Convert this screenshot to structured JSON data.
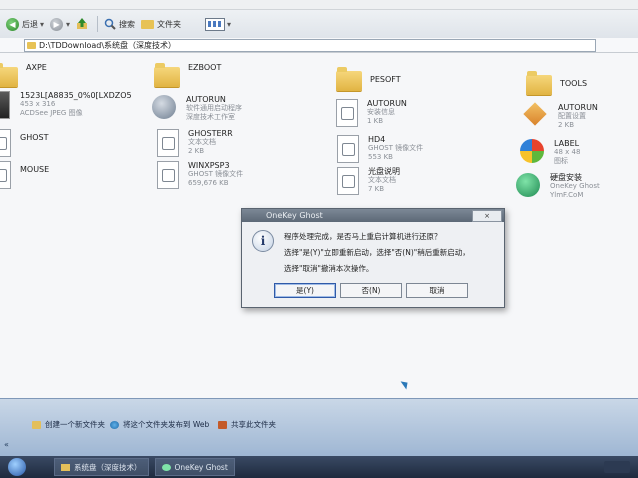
{
  "menubar": {
    "text": ""
  },
  "toolbar": {
    "back_label": "后退",
    "search_label": "搜索",
    "folders_label": "文件夹"
  },
  "address": {
    "path": "D:\\TDDownload\\系统盘（深度技术）"
  },
  "files": [
    {
      "name": "AXPE",
      "sub1": "",
      "sub2": "",
      "icon": "folder-icon"
    },
    {
      "name": "EZBOOT",
      "sub1": "",
      "sub2": "",
      "icon": "folder-icon"
    },
    {
      "name": "PESOFT",
      "sub1": "",
      "sub2": "",
      "icon": "folder-icon"
    },
    {
      "name": "TOOLS",
      "sub1": "",
      "sub2": "",
      "icon": "folder-icon"
    },
    {
      "name": "1523L[A8835_0%0[LXDZO5",
      "sub1": "453 x 316",
      "sub2": "ACDSee JPEG 图像",
      "icon": "image-icon"
    },
    {
      "name": "AUTORUN",
      "sub1": "软件通用启动程序",
      "sub2": "深度技术工作室",
      "icon": "app-icon"
    },
    {
      "name": "AUTORUN",
      "sub1": "安装信息",
      "sub2": "1 KB",
      "icon": "settings-file-icon"
    },
    {
      "name": "AUTORUN",
      "sub1": "配置设置",
      "sub2": "2 KB",
      "icon": "settings-file-icon"
    },
    {
      "name": "GHOST",
      "sub1": "",
      "sub2": "",
      "icon": "folder-icon"
    },
    {
      "name": "GHOSTERR",
      "sub1": "文本文档",
      "sub2": "2 KB",
      "icon": "text-file-icon"
    },
    {
      "name": "HD4",
      "sub1": "GHOST 镜像文件",
      "sub2": "553 KB",
      "icon": "ghost-file-icon"
    },
    {
      "name": "LABEL",
      "sub1": "48 x 48",
      "sub2": "图标",
      "icon": "windows-logo-icon"
    },
    {
      "name": "MOUSE",
      "sub1": "",
      "sub2": "",
      "icon": "folder-icon"
    },
    {
      "name": "WINXPSP3",
      "sub1": "GHOST 镜像文件",
      "sub2": "659,676 KB",
      "icon": "ghost-file-icon"
    },
    {
      "name": "光盘说明",
      "sub1": "文本文档",
      "sub2": "7 KB",
      "icon": "text-file-icon"
    },
    {
      "name": "硬盘安装",
      "sub1": "OneKey Ghost",
      "sub2": "YlmF.CoM",
      "icon": "onekey-ghost-icon"
    }
  ],
  "dialog": {
    "title": "OneKey Ghost",
    "close_label": "×",
    "line1": "程序处理完成，是否马上重启计算机进行还原？",
    "line2": "选择\"是(Y)\"立即重新启动，选择\"否(N)\"稍后重新启动，",
    "line3": "选择\"取消\"撤消本次操作。",
    "yes_label": "是(Y)",
    "no_label": "否(N)",
    "cancel_label": "取消"
  },
  "taskpane": {
    "link1": "创建一个新文件夹",
    "link2": "将这个文件夹发布到 Web",
    "link3": "共享此文件夹"
  },
  "taskbar": {
    "window1": "系统盘（深度技术）",
    "window2": "OneKey Ghost"
  }
}
